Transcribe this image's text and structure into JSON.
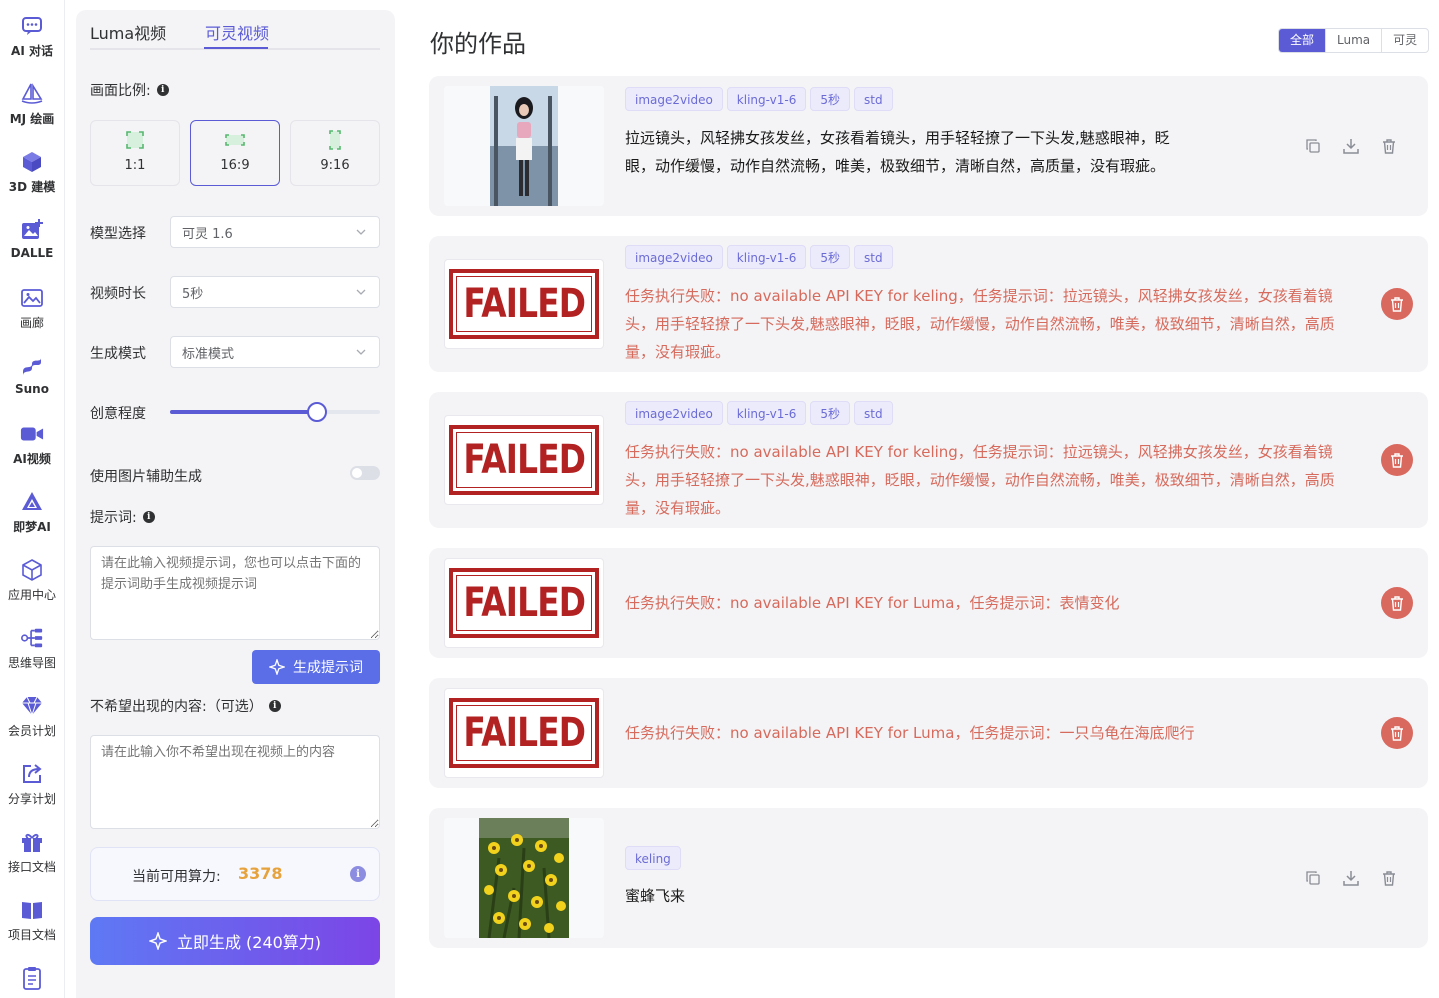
{
  "nav": {
    "items": [
      {
        "label": "AI 对话",
        "icon": "chat-icon"
      },
      {
        "label": "MJ 绘画",
        "icon": "sailboat-icon"
      },
      {
        "label": "3D 建模",
        "icon": "cube-icon"
      },
      {
        "label": "DALLE",
        "icon": "image-plus-icon"
      },
      {
        "label": "画廊",
        "icon": "gallery-icon"
      },
      {
        "label": "Suno",
        "icon": "music-icon"
      },
      {
        "label": "AI视频",
        "icon": "video-icon"
      },
      {
        "label": "即梦AI",
        "icon": "triangle-logo-icon"
      },
      {
        "label": "应用中心",
        "icon": "box-icon"
      },
      {
        "label": "思维导图",
        "icon": "mindmap-icon"
      },
      {
        "label": "会员计划",
        "icon": "diamond-icon"
      },
      {
        "label": "分享计划",
        "icon": "share-icon"
      },
      {
        "label": "接口文档",
        "icon": "gift-icon"
      },
      {
        "label": "项目文档",
        "icon": "book-icon"
      }
    ],
    "extra_icon": "clipboard-icon"
  },
  "panel": {
    "tabs": [
      "Luma视频",
      "可灵视频"
    ],
    "active_tab": 1,
    "aspect_label": "画面比例:",
    "ratios": [
      "1:1",
      "16:9",
      "9:16"
    ],
    "active_ratio": 1,
    "model_label": "模型选择",
    "model_value": "可灵 1.6",
    "duration_label": "视频时长",
    "duration_value": "5秒",
    "mode_label": "生成模式",
    "mode_value": "标准模式",
    "creativity_label": "创意程度",
    "creativity_value": 0.7,
    "image_assist_label": "使用图片辅助生成",
    "image_assist_on": false,
    "prompt_label": "提示词:",
    "prompt_placeholder": "请在此输入视频提示词，您也可以点击下面的提示词助手生成视频提示词",
    "gen_prompt_btn": "生成提示词",
    "negative_label": "不希望出现的内容:（可选）",
    "negative_placeholder": "请在此输入你不希望出现在视频上的内容",
    "power_label": "当前可用算力:",
    "power_value": "3378",
    "submit_btn": "立即生成 (240算力)"
  },
  "main": {
    "title": "你的作品",
    "filters": [
      "全部",
      "Luma",
      "可灵"
    ],
    "active_filter": 0,
    "cards": [
      {
        "type": "image",
        "thumb": "portrait",
        "tags": [
          "image2video",
          "kling-v1-6",
          "5秒",
          "std"
        ],
        "text": "拉远镜头，风轻拂女孩发丝，女孩看着镜头，用手轻轻撩了一下头发,魅惑眼神，眨眼，动作缓慢，动作自然流畅，唯美，极致细节，清晰自然，高质量，没有瑕疵。"
      },
      {
        "type": "failed",
        "thumb_text": "FAILED",
        "tags": [
          "image2video",
          "kling-v1-6",
          "5秒",
          "std"
        ],
        "text": "任务执行失败：no available API KEY for keling，任务提示词：拉远镜头，风轻拂女孩发丝，女孩看着镜头，用手轻轻撩了一下头发,魅惑眼神，眨眼，动作缓慢，动作自然流畅，唯美，极致细节，清晰自然，高质量，没有瑕疵。"
      },
      {
        "type": "failed",
        "thumb_text": "FAILED",
        "tags": [
          "image2video",
          "kling-v1-6",
          "5秒",
          "std"
        ],
        "text": "任务执行失败：no available API KEY for keling，任务提示词：拉远镜头，风轻拂女孩发丝，女孩看着镜头，用手轻轻撩了一下头发,魅惑眼神，眨眼，动作缓慢，动作自然流畅，唯美，极致细节，清晰自然，高质量，没有瑕疵。"
      },
      {
        "type": "failed",
        "thumb_text": "FAILED",
        "tags": [],
        "text": "任务执行失败：no available API KEY for Luma，任务提示词：表情变化"
      },
      {
        "type": "failed",
        "thumb_text": "FAILED",
        "tags": [],
        "text": "任务执行失败：no available API KEY for Luma，任务提示词：一只乌龟在海底爬行"
      },
      {
        "type": "image",
        "thumb": "flowers",
        "tags": [
          "keling"
        ],
        "text": "蜜蜂飞来"
      }
    ]
  },
  "colors": {
    "accent": "#5b5bd6",
    "error": "#d66a5c",
    "delete": "#d9695f",
    "power": "#e6a23c"
  }
}
